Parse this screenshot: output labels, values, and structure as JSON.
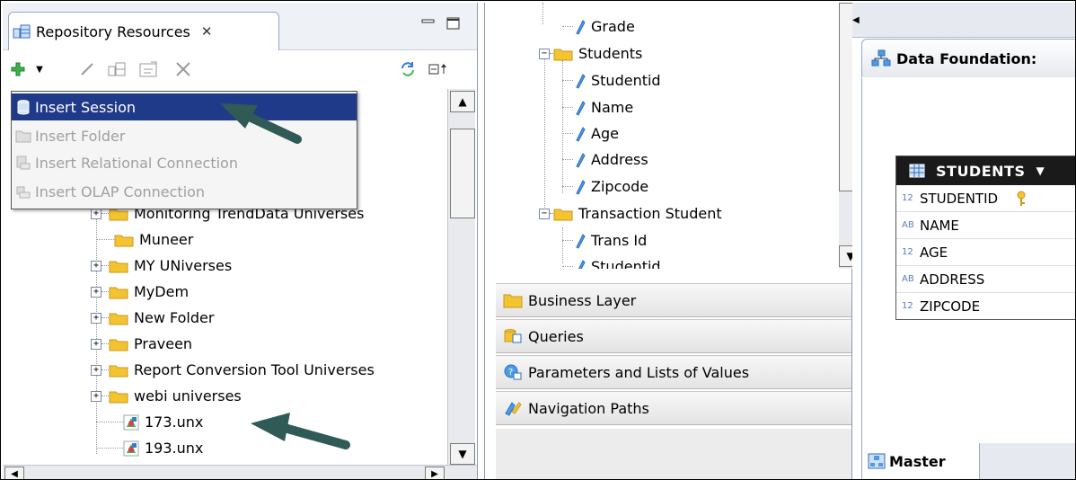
{
  "repository_panel": {
    "tab_title": "Repository Resources",
    "tab_close_glyph": "✕",
    "toolbar_icons": [
      "add-icon",
      "dropdown-arrow-icon",
      "edit-icon",
      "session-icon",
      "properties-icon",
      "delete-icon",
      "refresh-icon",
      "collapse-all-icon"
    ],
    "context_menu": [
      {
        "label": "Insert Session",
        "enabled": true,
        "selected": true
      },
      {
        "label": "Insert Folder",
        "enabled": false
      },
      {
        "label": "Insert Relational Connection",
        "enabled": false
      },
      {
        "label": "Insert OLAP Connection",
        "enabled": false
      }
    ],
    "tree_items": [
      {
        "label": "Monitoring TrendData Universes",
        "type": "folder",
        "expandable": true
      },
      {
        "label": "Muneer",
        "type": "folder",
        "expandable": false
      },
      {
        "label": "MY UNiverses",
        "type": "folder",
        "expandable": true
      },
      {
        "label": "MyDem",
        "type": "folder",
        "expandable": true
      },
      {
        "label": "New Folder",
        "type": "folder",
        "expandable": true
      },
      {
        "label": "Praveen",
        "type": "folder",
        "expandable": true
      },
      {
        "label": "Report Conversion Tool Universes",
        "type": "folder",
        "expandable": true
      },
      {
        "label": "webi universes",
        "type": "folder",
        "expandable": true
      },
      {
        "label": "173.unx",
        "type": "universe",
        "expandable": false
      },
      {
        "label": "193.unx",
        "type": "universe",
        "expandable": false
      }
    ]
  },
  "data_tree": {
    "items": [
      {
        "label": "Grade",
        "type": "column"
      },
      {
        "label": "Students",
        "type": "table"
      },
      {
        "label": "Studentid",
        "type": "column"
      },
      {
        "label": "Name",
        "type": "column"
      },
      {
        "label": "Age",
        "type": "column"
      },
      {
        "label": "Address",
        "type": "column"
      },
      {
        "label": "Zipcode",
        "type": "column"
      },
      {
        "label": "Transaction Student",
        "type": "table"
      },
      {
        "label": "Trans Id",
        "type": "column"
      },
      {
        "label": "Studentid",
        "type": "column"
      }
    ]
  },
  "accordion": [
    {
      "label": "Business Layer",
      "icon": "folder-icon"
    },
    {
      "label": "Queries",
      "icon": "queries-icon"
    },
    {
      "label": "Parameters and Lists of Values",
      "icon": "parameters-icon"
    },
    {
      "label": "Navigation Paths",
      "icon": "navigation-paths-icon"
    }
  ],
  "data_foundation": {
    "header": "Data Foundation:",
    "table": {
      "name": "STUDENTS",
      "columns": [
        {
          "type": "12",
          "name": "STUDENTID",
          "key": true
        },
        {
          "type": "AB",
          "name": "NAME",
          "key": false
        },
        {
          "type": "12",
          "name": "AGE",
          "key": false
        },
        {
          "type": "AB",
          "name": "ADDRESS",
          "key": false
        },
        {
          "type": "12",
          "name": "ZIPCODE",
          "key": false
        }
      ]
    },
    "bottom_tab": "Master"
  },
  "colors": {
    "menu_selected": "#203a8a",
    "arrow": "#2f5a55",
    "table_header": "#1a1a1a",
    "folder": "#f4c430"
  }
}
